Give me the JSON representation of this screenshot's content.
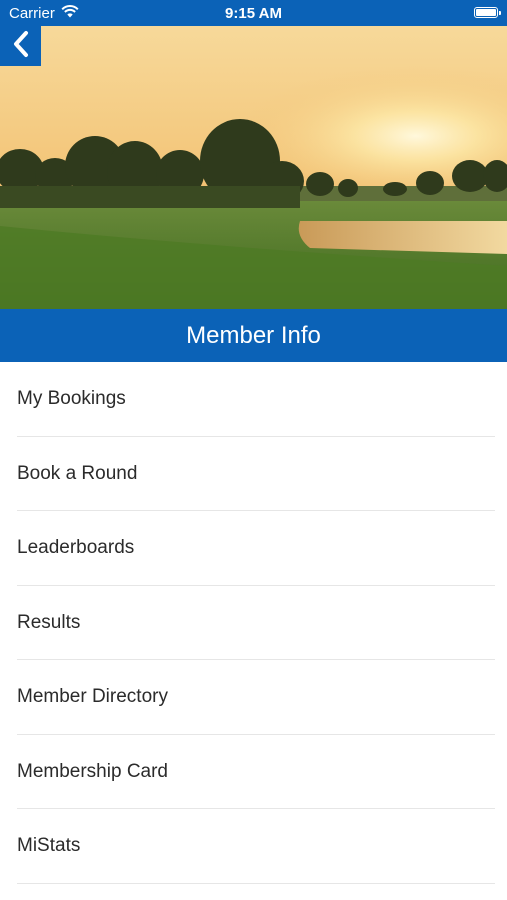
{
  "status_bar": {
    "carrier": "Carrier",
    "time": "9:15 AM",
    "icons": [
      "wifi-icon",
      "battery-icon"
    ]
  },
  "header": {
    "title": "Member Info",
    "back_icon": "chevron-left-icon"
  },
  "hero": {
    "description_icon": "golf-course-sunset-image"
  },
  "menu": {
    "items": [
      {
        "label": "My Bookings"
      },
      {
        "label": "Book a Round"
      },
      {
        "label": "Leaderboards"
      },
      {
        "label": "Results"
      },
      {
        "label": "Member Directory"
      },
      {
        "label": "Membership Card"
      },
      {
        "label": "MiStats"
      }
    ]
  },
  "colors": {
    "brand_blue": "#0b62b7",
    "background": "#ffffff",
    "text": "#2b2b2b",
    "divider": "#e6e6e6"
  }
}
